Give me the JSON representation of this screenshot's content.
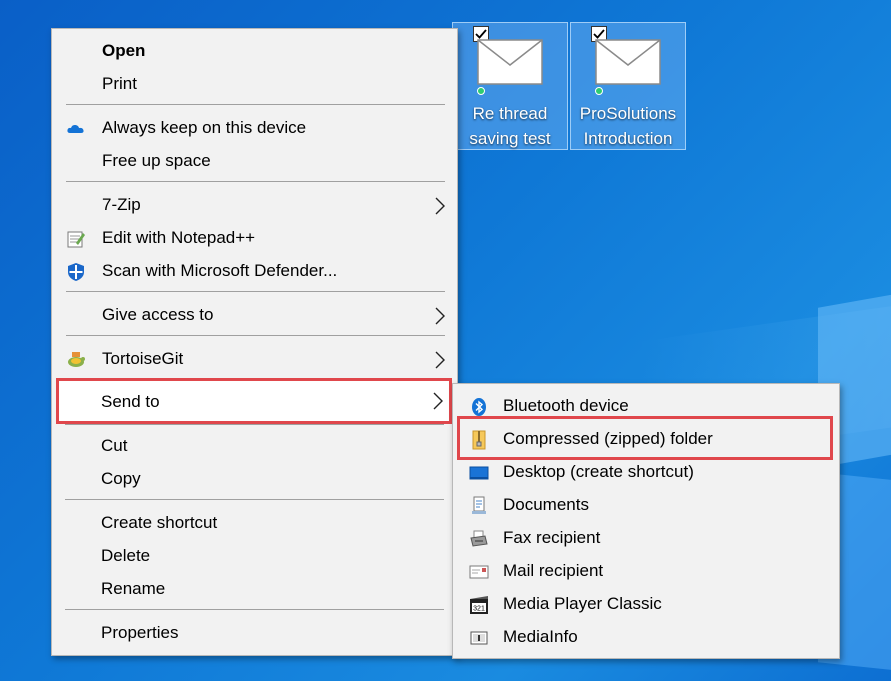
{
  "desktop": {
    "icons": [
      {
        "line1": "Re thread",
        "line2": "saving test"
      },
      {
        "line1": "ProSolutions",
        "line2": "Introduction"
      }
    ]
  },
  "context_menu": {
    "open": "Open",
    "print": "Print",
    "always_keep": "Always keep on this device",
    "free_up": "Free up space",
    "zip7": "7-Zip",
    "notepad": "Edit with Notepad++",
    "defender": "Scan with Microsoft Defender...",
    "give_access": "Give access to",
    "tortoisegit": "TortoiseGit",
    "send_to": "Send to",
    "cut": "Cut",
    "copy": "Copy",
    "create_shortcut": "Create shortcut",
    "delete": "Delete",
    "rename": "Rename",
    "properties": "Properties"
  },
  "send_to_menu": {
    "bluetooth": "Bluetooth device",
    "compressed": "Compressed (zipped) folder",
    "desktop": "Desktop (create shortcut)",
    "documents": "Documents",
    "fax": "Fax recipient",
    "mail": "Mail recipient",
    "mpc": "Media Player Classic",
    "mediainfo": "MediaInfo"
  },
  "colors": {
    "highlight_border": "#e0474c",
    "menu_bg": "#f2f2f2",
    "desktop_bg": "#0f78d6"
  }
}
